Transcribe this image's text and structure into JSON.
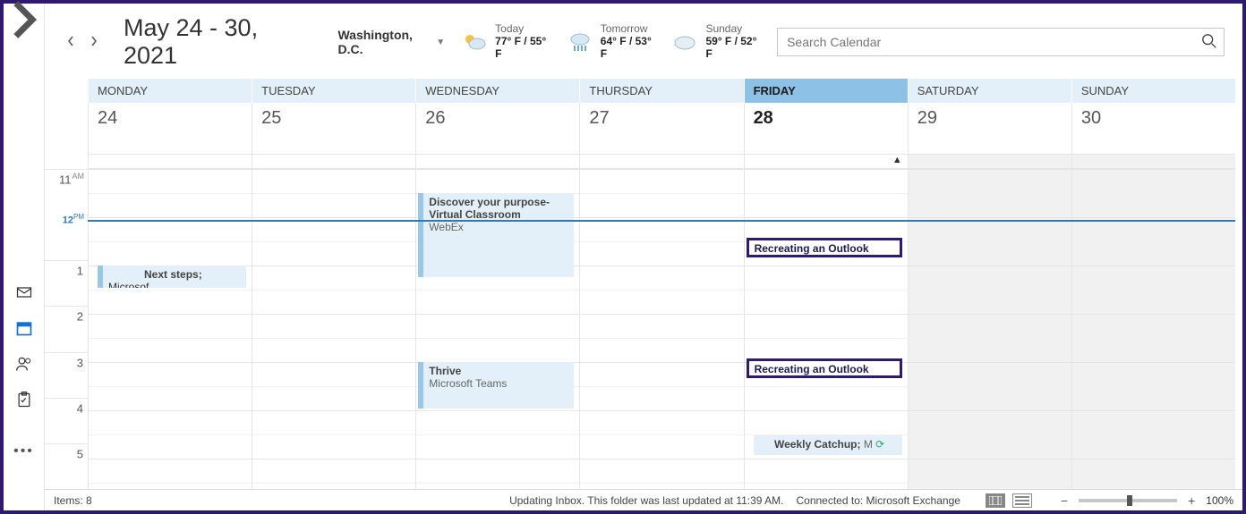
{
  "header": {
    "date_range": "May 24 - 30, 2021",
    "location": "Washington,  D.C.",
    "weather": [
      {
        "label": "Today",
        "temps": "77° F / 55° F",
        "icon": "sun-cloud"
      },
      {
        "label": "Tomorrow",
        "temps": "64° F / 53° F",
        "icon": "rain"
      },
      {
        "label": "Sunday",
        "temps": "59° F / 52° F",
        "icon": "cloud"
      }
    ],
    "search_placeholder": "Search Calendar"
  },
  "days": [
    {
      "name": "MONDAY",
      "date": "24"
    },
    {
      "name": "TUESDAY",
      "date": "25"
    },
    {
      "name": "WEDNESDAY",
      "date": "26"
    },
    {
      "name": "THURSDAY",
      "date": "27"
    },
    {
      "name": "FRIDAY",
      "date": "28",
      "today": true
    },
    {
      "name": "SATURDAY",
      "date": "29",
      "weekend": true
    },
    {
      "name": "SUNDAY",
      "date": "30",
      "weekend": true
    }
  ],
  "time_labels": [
    {
      "h": "11",
      "ampm": "AM"
    },
    {
      "h": "12",
      "ampm": "PM",
      "now": true
    },
    {
      "h": "1",
      "ampm": ""
    },
    {
      "h": "2",
      "ampm": ""
    },
    {
      "h": "3",
      "ampm": ""
    },
    {
      "h": "4",
      "ampm": ""
    },
    {
      "h": "5",
      "ampm": ""
    }
  ],
  "events": {
    "discover": {
      "title": "Discover your purpose- Virtual Classroom",
      "location": "WebEx"
    },
    "nextsteps": {
      "title": "Next steps;",
      "org": " Microsof"
    },
    "thrive": {
      "title": "Thrive",
      "location": "Microsoft Teams"
    },
    "recreate": "Recreating an Outlook Meet",
    "catchup": {
      "title": "Weekly Catchup;",
      "trunc": " M"
    }
  },
  "status": {
    "items": "Items: 8",
    "updating": "Updating Inbox.  This folder was last updated at 11:39 AM.",
    "connection": "Connected to: Microsoft Exchange",
    "zoom": "100%"
  }
}
